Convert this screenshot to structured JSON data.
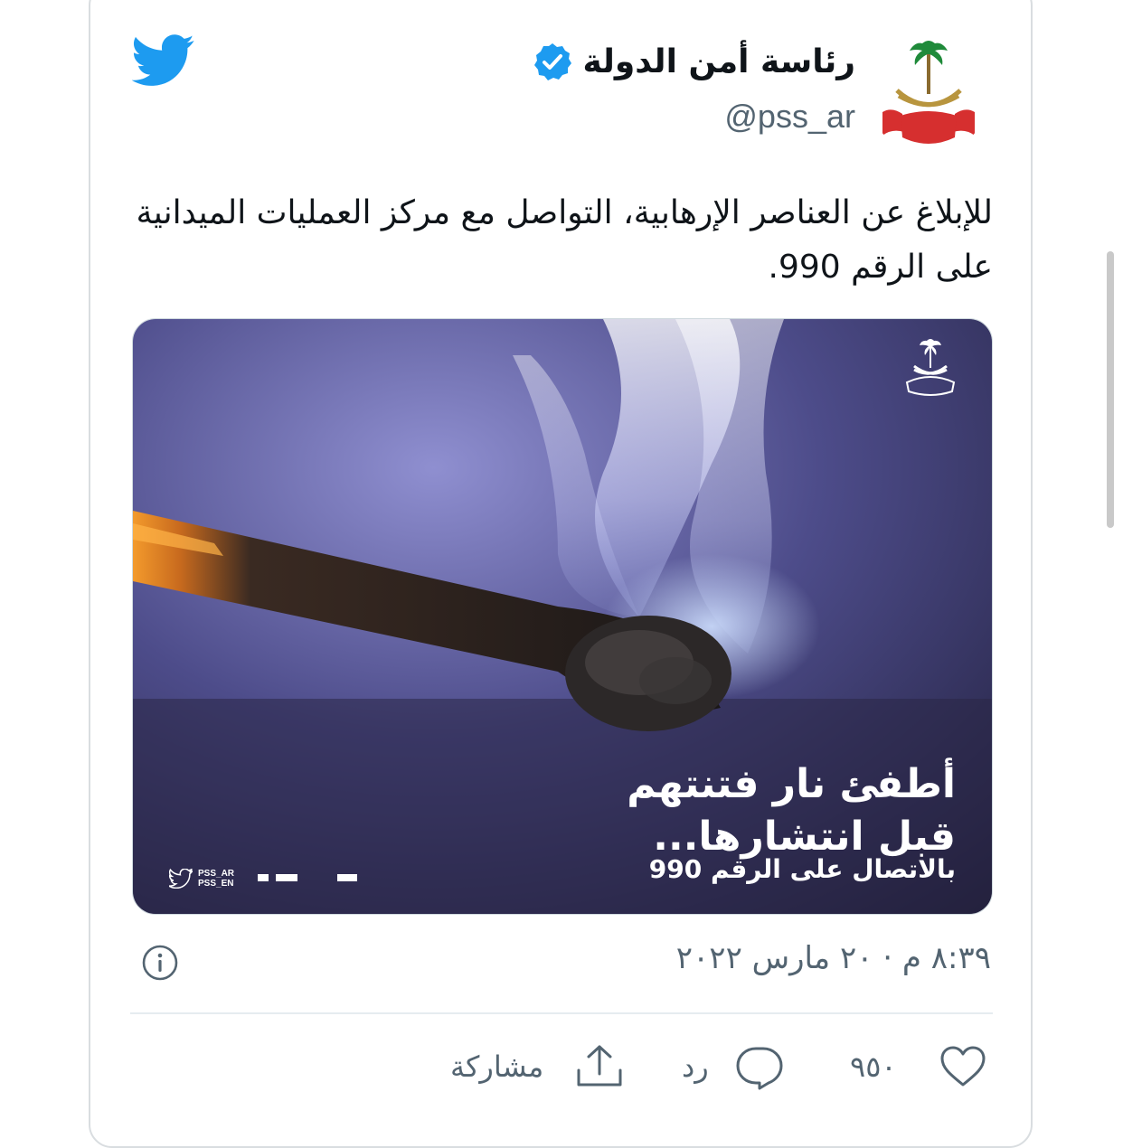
{
  "tweet": {
    "display_name": "رئاسة أمن الدولة",
    "handle": "@pss_ar",
    "text_line1": "للإبلاغ عن العناصر الإرهابية، التواصل مع مركز العمليات الميدانية",
    "text_line2": "على الرقم 990.",
    "timestamp": "٨:٣٩ م · ٢٠ مارس ٢٠٢٢"
  },
  "media": {
    "headline_line1": "أطفئ نار فتنتهم",
    "headline_line2": "قبل انتشارها...",
    "subline": "بالاتصال على الرقم 990",
    "handle_ar": "PSS_AR",
    "handle_en": "PSS_EN"
  },
  "actions": {
    "like_count": "٩٥٠",
    "reply_label": "رد",
    "share_label": "مشاركة"
  },
  "colors": {
    "twitter_blue": "#1d9bf0",
    "text": "#0f1419",
    "secondary": "#536471"
  },
  "icons": [
    "twitter-bird-icon",
    "verified-badge-icon",
    "info-icon",
    "heart-icon",
    "reply-icon",
    "share-icon"
  ]
}
